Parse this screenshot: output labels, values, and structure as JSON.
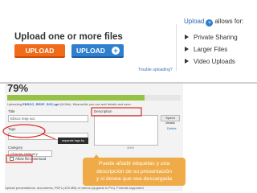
{
  "upload_panel": {
    "title": "Upload one or more files",
    "upload_button": "UPLOAD",
    "upload_plus_button": "UPLOAD",
    "trouble_link": "Trouble uploading?",
    "side_heading_upload": "Upload",
    "side_heading_rest": "allows for:",
    "side_items": [
      "Private Sharing",
      "Larger Files",
      "Video Uploads"
    ]
  },
  "progress": {
    "percent_label": "79%",
    "value_fraction": 0.79,
    "uploading_prefix": "Uploading",
    "uploading_file": "EBSCO_RESP_SOC.ppt",
    "uploading_rest": "(543kb). Meanwhile you can add details and save."
  },
  "form": {
    "title_label": "Title",
    "title_value": "Ebsco resp soc",
    "description_label": "Description",
    "speed_details_button": "Speed details",
    "delete_link": "Delete",
    "tags_label": "Tags",
    "tooltip": "separate tags by comma",
    "char_count": "3000",
    "category_label": "Category",
    "category_value": "Choose category",
    "allow_download": "Allow file download",
    "bottom_note": "Upload presentations, documents, PDFs (100 MB) or videos (upgrade to Pro). Formats supported"
  },
  "callout": {
    "line1": "Puede añadir etiquetas y una",
    "line2": "descripción de su presentación",
    "line3": "y si desea que sea descargada"
  },
  "colors": {
    "orange_button": "#f06b1a",
    "blue_button": "#2f7fcf",
    "progress_green": "#97c248",
    "callout": "#eea73e",
    "annotation_red": "#d9302a"
  }
}
